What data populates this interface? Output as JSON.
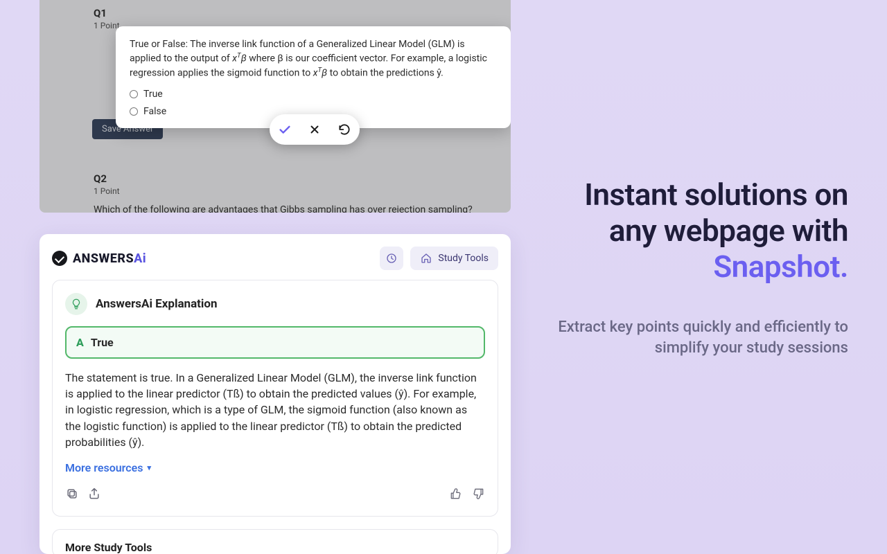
{
  "quiz": {
    "q1": {
      "num": "Q1",
      "points": "1 Point",
      "stem_a": "True or False: The inverse link function of a Generalized Linear Model (GLM) is applied to the output of ",
      "stem_b": " where β is our coefficient vector. For example, a logistic regression applies the sigmoid function to ",
      "stem_c": " to obtain the predictions ŷ.",
      "xTb": "x",
      "opt_true": "True",
      "opt_false": "False",
      "save": "Save Answer"
    },
    "q2": {
      "num": "Q2",
      "points": "1 Point",
      "text": "Which of the following are advantages that Gibbs sampling has over rejection sampling?"
    }
  },
  "panel": {
    "brand_a": "ANSWERS",
    "brand_b": "Ai",
    "study_tools": "Study Tools",
    "exp_title": "AnswersAi Explanation",
    "answer_letter": "A",
    "answer": "True",
    "explanation": "The statement is true. In a Generalized Linear Model (GLM), the inverse link function is applied to the linear predictor (Tß) to obtain the predicted values (ŷ). For example, in logistic regression, which is a type of GLM, the sigmoid function (also known as the logistic function) is applied to the linear predictor (Tß) to obtain the predicted probabilities (ŷ).",
    "more": "More resources",
    "more_tools": "More Study Tools"
  },
  "hero": {
    "line1": "Instant solutions on",
    "line2": "any webpage with",
    "line3": "Snapshot.",
    "sub": "Extract key points quickly and efficiently to simplify your study sessions"
  }
}
